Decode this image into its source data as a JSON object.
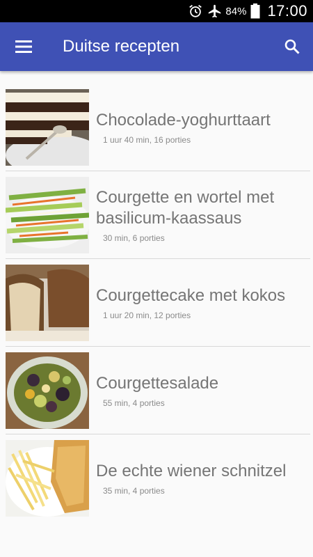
{
  "status_bar": {
    "battery_percent": "84%",
    "time": "17:00",
    "icons": [
      "alarm-icon",
      "airplane-mode-icon",
      "battery-icon"
    ]
  },
  "app_bar": {
    "title": "Duitse recepten",
    "menu_icon": "hamburger-menu-icon",
    "search_icon": "search-icon",
    "color": "#3f51b5"
  },
  "recipes": [
    {
      "title": "Chocolade-yoghurttaart",
      "meta": "1 uur 40 min, 16 porties"
    },
    {
      "title": "Courgette en wortel met basilicum-kaassaus",
      "meta": "30 min, 6 porties"
    },
    {
      "title": "Courgettecake met kokos",
      "meta": "1 uur 20 min, 12 porties"
    },
    {
      "title": "Courgettesalade",
      "meta": "55 min, 4 porties"
    },
    {
      "title": "De echte wiener schnitzel",
      "meta": "35 min, 4 porties"
    }
  ]
}
